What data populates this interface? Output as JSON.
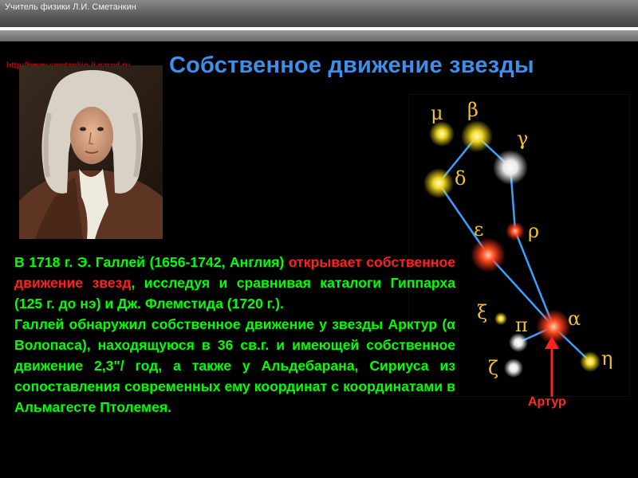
{
  "header": {
    "author": "Учитель физики Л.И. Сметанкин",
    "url": "http://www.smetankin-li.narod.ru"
  },
  "title": "Собственное движение звезды",
  "paragraph1": {
    "part1": "В 1718 г. Э. Галлей (1656-1742, Англия) ",
    "part2_red": "открывает собственное движение звезд",
    "part3": ", исследуя и сравнивая каталоги Гиппарха (125 г. до нэ) и Дж. Флемстида (1720 г.)."
  },
  "paragraph2": "Галлей обнаружил собственное движение у звезды Арктур (α Волопаса), находящуюся в 36 св.г.  и имеющей собственное движение 2,3\"/ год, а также у Альдебарана, Сириуса из сопоставления современных ему координат с координатами в Альмагесте Птолемея.",
  "stars": {
    "mu": "μ",
    "beta": "β",
    "gamma": "γ",
    "delta": "δ",
    "epsilon": "ε",
    "rho": "ρ",
    "xi": "ξ",
    "pi": "π",
    "alpha": "α",
    "eta": "η",
    "zeta": "ζ"
  },
  "arrow_label": "Артур",
  "colors": {
    "title": "#3d8fe8",
    "text": "#00ff00",
    "highlight": "#ff2020",
    "lines": "#3aa0ff"
  }
}
